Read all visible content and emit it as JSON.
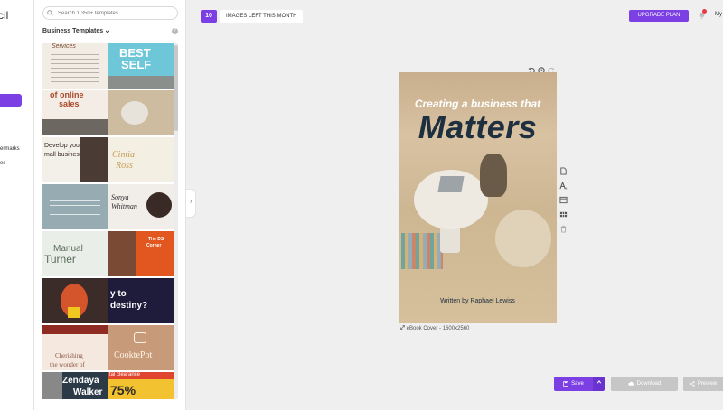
{
  "nav": {
    "brand": "cil",
    "items": [
      {
        "label": "ermarks"
      },
      {
        "label": "es"
      }
    ]
  },
  "panel": {
    "search_placeholder": "Search 1,350+ templates",
    "section_title": "Business Templates",
    "templates": [
      {
        "lines": [
          "Services"
        ],
        "bg": "#f1ece4"
      },
      {
        "lines": [
          "BEST",
          "SELF"
        ],
        "bg": "#6ec6d9"
      },
      {
        "lines": [
          "of online",
          "sales"
        ],
        "bg": "#f4ede6"
      },
      {
        "lines": [],
        "bg": "#cdbc9f"
      },
      {
        "lines": [
          "Develop your",
          "mall business"
        ],
        "bg": "#f3efe9"
      },
      {
        "lines": [
          "Cintia",
          "Ross"
        ],
        "bg": "#f4efe3"
      },
      {
        "lines": [],
        "bg": "#97abb2"
      },
      {
        "lines": [
          "Sonya",
          "Whitman"
        ],
        "bg": "#f1eeea"
      },
      {
        "lines": [
          "Manual",
          "Turner"
        ],
        "bg": "#e9efe8"
      },
      {
        "lines": [
          "The DS",
          "Corner"
        ],
        "bg": "#e2561f"
      },
      {
        "lines": [],
        "bg": "#3b2c2a"
      },
      {
        "lines": [
          "y to",
          "destiny?"
        ],
        "bg": "#1f1b3b"
      },
      {
        "lines": [
          "Cherishing",
          "the wonder of"
        ],
        "bg": "#f5e8df"
      },
      {
        "lines": [
          "CooktePot"
        ],
        "bg": "#c79a79"
      },
      {
        "lines": [
          "Zendaya",
          "Walker"
        ],
        "bg": "#2c3a47"
      },
      {
        "lines": [
          "tal clearance",
          "75%"
        ],
        "bg": "#f2c230"
      }
    ]
  },
  "topbar": {
    "images_count": "10",
    "images_label": "IMAGES LEFT THIS MONTH",
    "upgrade_label": "UPGRADE PLAN",
    "my_label": "My"
  },
  "cover": {
    "subtitle": "Creating a business that",
    "title": "Matters",
    "author": "Written by Raphael Lewiss"
  },
  "canvas": {
    "caption": "eBook Cover - 1600x2560"
  },
  "actions": {
    "save_label": "Save",
    "download_label": "Download",
    "preview_label": "Preview"
  },
  "colors": {
    "accent": "#7b3fe4",
    "disabled": "#c6c6c6",
    "cover_title": "#1e2f3f"
  },
  "icons": [
    "search-icon",
    "chevron-down-icon",
    "help-icon",
    "chevron-right-icon",
    "bell-icon",
    "undo-icon",
    "history-icon",
    "redo-icon",
    "page-icon",
    "text-icon",
    "layout-icon",
    "grid-icon",
    "trash-icon",
    "resize-icon",
    "save-icon",
    "chevron-up-icon",
    "cloud-download-icon",
    "share-icon"
  ]
}
